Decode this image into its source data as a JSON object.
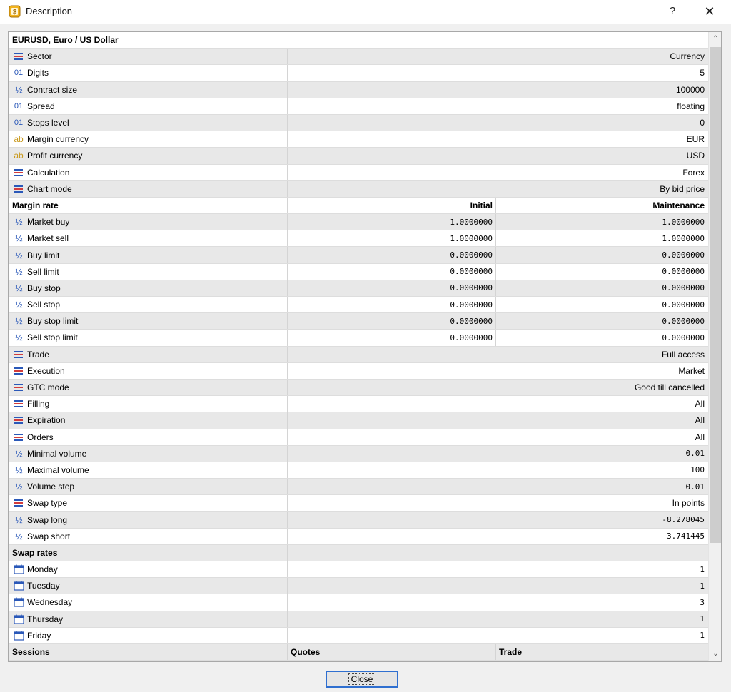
{
  "window": {
    "title": "Description",
    "help_label": "?",
    "close_label": "✕"
  },
  "symbol_title": "EURUSD, Euro / US Dollar",
  "general": [
    {
      "icon": "list-icon",
      "label": "Sector",
      "value": "Currency"
    },
    {
      "icon": "digits-icon",
      "label": "Digits",
      "value": "5"
    },
    {
      "icon": "fraction-icon",
      "label": "Contract size",
      "value": "100000"
    },
    {
      "icon": "digits-icon",
      "label": "Spread",
      "value": "floating"
    },
    {
      "icon": "digits-icon",
      "label": "Stops level",
      "value": "0"
    },
    {
      "icon": "text-icon",
      "label": "Margin currency",
      "value": "EUR"
    },
    {
      "icon": "text-icon",
      "label": "Profit currency",
      "value": "USD"
    },
    {
      "icon": "list-icon",
      "label": "Calculation",
      "value": "Forex"
    },
    {
      "icon": "list-icon",
      "label": "Chart mode",
      "value": "By bid price"
    }
  ],
  "margin_rate": {
    "header": "Margin rate",
    "col_initial": "Initial",
    "col_maintenance": "Maintenance",
    "rows": [
      {
        "label": "Market buy",
        "initial": "1.0000000",
        "maintenance": "1.0000000"
      },
      {
        "label": "Market sell",
        "initial": "1.0000000",
        "maintenance": "1.0000000"
      },
      {
        "label": "Buy limit",
        "initial": "0.0000000",
        "maintenance": "0.0000000"
      },
      {
        "label": "Sell limit",
        "initial": "0.0000000",
        "maintenance": "0.0000000"
      },
      {
        "label": "Buy stop",
        "initial": "0.0000000",
        "maintenance": "0.0000000"
      },
      {
        "label": "Sell stop",
        "initial": "0.0000000",
        "maintenance": "0.0000000"
      },
      {
        "label": "Buy stop limit",
        "initial": "0.0000000",
        "maintenance": "0.0000000"
      },
      {
        "label": "Sell stop limit",
        "initial": "0.0000000",
        "maintenance": "0.0000000"
      }
    ]
  },
  "trading": [
    {
      "icon": "list-icon",
      "label": "Trade",
      "value": "Full access"
    },
    {
      "icon": "list-icon",
      "label": "Execution",
      "value": "Market"
    },
    {
      "icon": "list-icon",
      "label": "GTC mode",
      "value": "Good till cancelled"
    },
    {
      "icon": "list-icon",
      "label": "Filling",
      "value": "All"
    },
    {
      "icon": "list-icon",
      "label": "Expiration",
      "value": "All"
    },
    {
      "icon": "list-icon",
      "label": "Orders",
      "value": "All"
    },
    {
      "icon": "fraction-icon",
      "label": "Minimal volume",
      "value": "0.01"
    },
    {
      "icon": "fraction-icon",
      "label": "Maximal volume",
      "value": "100"
    },
    {
      "icon": "fraction-icon",
      "label": "Volume step",
      "value": "0.01"
    },
    {
      "icon": "list-icon",
      "label": "Swap type",
      "value": "In points"
    },
    {
      "icon": "fraction-icon",
      "label": "Swap long",
      "value": "-8.278045"
    },
    {
      "icon": "fraction-icon",
      "label": "Swap short",
      "value": "3.741445"
    }
  ],
  "swap_rates": {
    "header": "Swap rates",
    "rows": [
      {
        "label": "Monday",
        "value": "1"
      },
      {
        "label": "Tuesday",
        "value": "1"
      },
      {
        "label": "Wednesday",
        "value": "3"
      },
      {
        "label": "Thursday",
        "value": "1"
      },
      {
        "label": "Friday",
        "value": "1"
      }
    ]
  },
  "sessions": {
    "header": "Sessions",
    "col_quotes": "Quotes",
    "col_trade": "Trade"
  },
  "footer": {
    "close_button_label": "Close"
  }
}
